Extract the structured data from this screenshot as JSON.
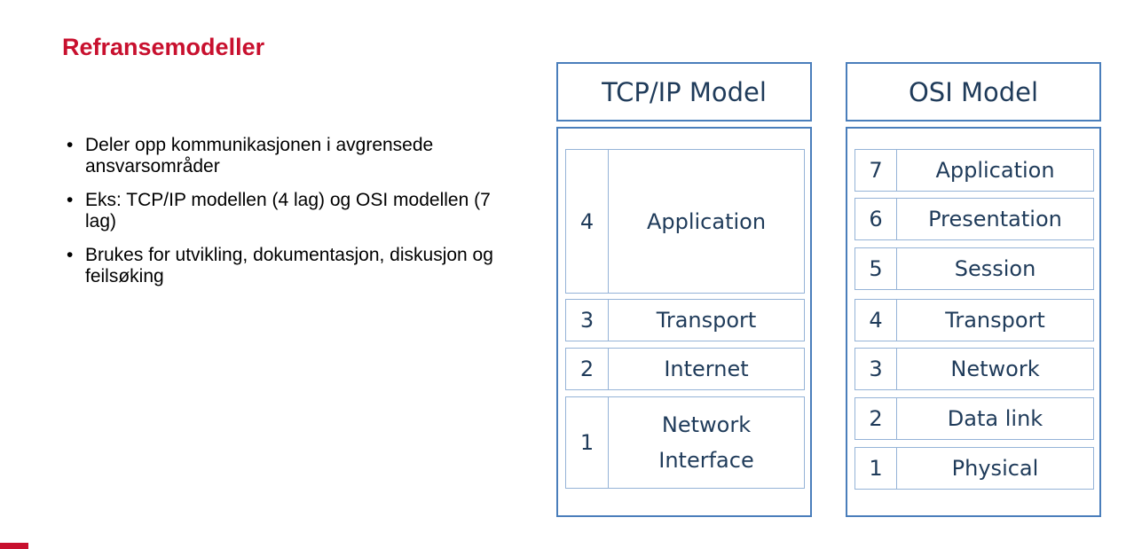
{
  "slide": {
    "title": "Refransemodeller",
    "bullets": [
      "Deler opp kommunikasjonen i avgrensede ansvarsområder",
      "Eks: TCP/IP modellen (4 lag) og OSI modellen (7 lag)",
      "Brukes for utvikling, dokumentasjon, diskusjon og feilsøking"
    ],
    "bullet_symbol": "•"
  },
  "tcp_model": {
    "title": "TCP/IP Model",
    "layers": [
      {
        "number": "4",
        "name": "Application"
      },
      {
        "number": "3",
        "name": "Transport"
      },
      {
        "number": "2",
        "name": "Internet"
      },
      {
        "number": "1",
        "name": "Network Interface"
      }
    ]
  },
  "osi_model": {
    "title": "OSI Model",
    "layers": [
      {
        "number": "7",
        "name": "Application"
      },
      {
        "number": "6",
        "name": "Presentation"
      },
      {
        "number": "5",
        "name": "Session"
      },
      {
        "number": "4",
        "name": "Transport"
      },
      {
        "number": "3",
        "name": "Network"
      },
      {
        "number": "2",
        "name": "Data link"
      },
      {
        "number": "1",
        "name": "Physical"
      }
    ]
  },
  "colors": {
    "title_red": "#c8102e",
    "box_border": "#4a7ebb",
    "row_border": "#95b3d7",
    "diagram_text": "#1f3b5a"
  }
}
